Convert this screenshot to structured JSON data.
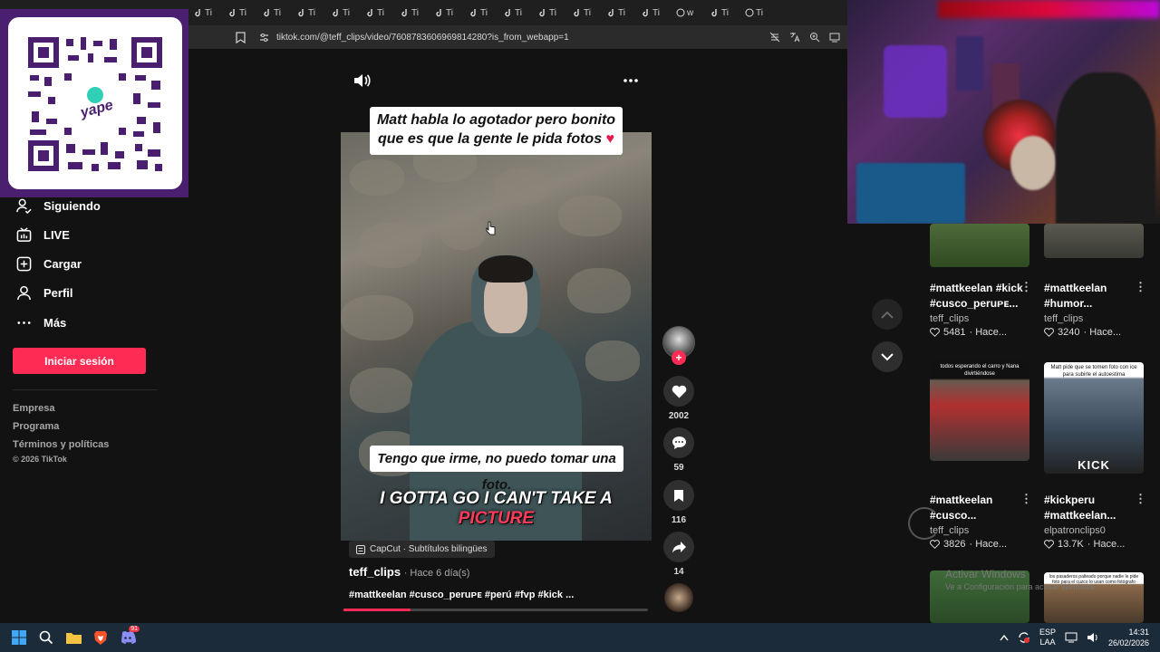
{
  "browser": {
    "tab_label": "Ti",
    "tab_label_w": "w",
    "url": "tiktok.com/@teff_clips/video/7608783606969814280?is_from_webapp=1"
  },
  "sidebar": {
    "items": [
      {
        "label": "Siguiendo",
        "icon": "following-icon"
      },
      {
        "label": "LIVE",
        "icon": "live-icon"
      },
      {
        "label": "Cargar",
        "icon": "upload-icon"
      },
      {
        "label": "Perfil",
        "icon": "profile-icon"
      },
      {
        "label": "Más",
        "icon": "more-icon"
      }
    ],
    "login_label": "Iniciar sesión",
    "footer": [
      "Empresa",
      "Programa",
      "Términos y políticas"
    ],
    "copyright": "© 2026 TikTok"
  },
  "qr": {
    "brand": "yape"
  },
  "video": {
    "caption_top_line1": "Matt habla lo agotador pero  bonito",
    "caption_top_line2": "que es que la gente le pida fotos",
    "caption_mid": "Tengo que irme, no puedo tomar una foto.",
    "caption_en_main": "I GOTTA GO I CAN'T TAKE A ",
    "caption_en_hl": "PICTURE",
    "capcut_label": "CapCut · Subtítulos bilingües",
    "author": "teff_clips",
    "posted": "· Hace 6 día(s)",
    "tags": "#mattkeelan #cusco_peruᴘᴇ #perú #fvp #kick ...",
    "progress": 0.22
  },
  "actions": {
    "likes": "2002",
    "comments": "59",
    "saves": "116",
    "shares": "14"
  },
  "right_cards": [
    {
      "title1": "#mattkeelan #kick",
      "title2": "#cusco_peruᴘᴇ...",
      "user": "teff_clips",
      "stat": "5481",
      "time": "· Hace..."
    },
    {
      "title1": "#mattkeelan",
      "title2": "#humor...",
      "user": "teff_clips",
      "stat": "3240",
      "time": "· Hace..."
    },
    {
      "title1": "#mattkeelan",
      "title2": "#cusco...",
      "user": "teff_clips",
      "stat": "3826",
      "time": "· Hace...",
      "thumb_text": "todos esperando el carro y Nana divirtiéndose"
    },
    {
      "title1": "#kickperu",
      "title2": "#mattkeelan...",
      "user": "elpatronclips0",
      "stat": "13.7K",
      "time": "· Hace...",
      "thumb_text": "Matt pide que se tomen foto con ice para subirle el autoestima",
      "thumb_badge": "KICK"
    }
  ],
  "bottom_thumb_text": "los pasaderos palteado porque nadie le pide foto para el cuzco lo usan como fotógrafo",
  "windows_watermark": {
    "line1": "Activar Windows",
    "line2": "Ve a Configuración para activar Windows."
  },
  "taskbar": {
    "lang1": "ESP",
    "lang2": "LAA",
    "time": "14:31",
    "date": "26/02/2026",
    "discord_badge": "91"
  },
  "colors": {
    "accent": "#fe2c55",
    "qr_frame": "#4b1f6f",
    "taskbar": "#1c2b3a"
  }
}
